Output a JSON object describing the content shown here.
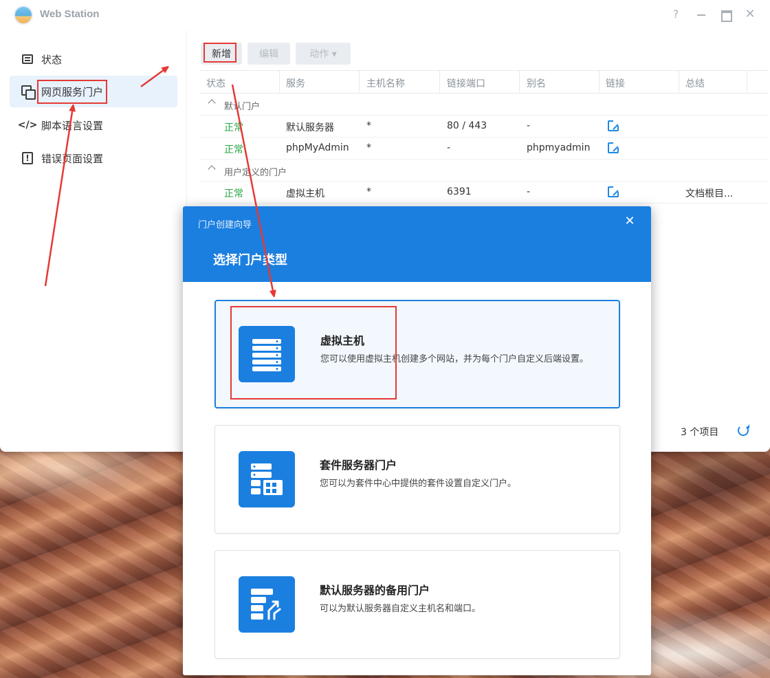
{
  "window": {
    "title": "Web Station",
    "controls": {
      "help": "?",
      "close": "✕"
    }
  },
  "sidebar": {
    "items": [
      {
        "label": "状态",
        "icon": "status-icon"
      },
      {
        "label": "网页服务门户",
        "icon": "portal-icon",
        "active": true
      },
      {
        "label": "脚本语言设置",
        "icon": "code-icon",
        "glyph": "</>"
      },
      {
        "label": "错误页面设置",
        "icon": "error-page-icon",
        "glyph": "!"
      }
    ]
  },
  "toolbar": {
    "new_label": "新增",
    "edit_label": "编辑",
    "action_label": "动作 ▾"
  },
  "table": {
    "columns": [
      "状态",
      "服务",
      "主机名称",
      "链接端口",
      "别名",
      "链接",
      "总结"
    ],
    "groups": [
      {
        "label": "默认门户",
        "rows": [
          {
            "status": "正常",
            "service": "默认服务器",
            "host": "*",
            "port": "80 / 443",
            "alias": "-",
            "summary": ""
          },
          {
            "status": "正常",
            "service": "phpMyAdmin",
            "host": "*",
            "port": "-",
            "alias": "phpmyadmin",
            "summary": ""
          }
        ]
      },
      {
        "label": "用户定义的门户",
        "rows": [
          {
            "status": "正常",
            "service": "虚拟主机",
            "host": "*",
            "port": "6391",
            "alias": "-",
            "summary": "文档根目..."
          }
        ]
      }
    ],
    "item_count": "3 个项目"
  },
  "modal": {
    "small_title": "门户创建向导",
    "title": "选择门户类型",
    "close": "✕",
    "options": [
      {
        "name": "虚拟主机",
        "desc": "您可以使用虚拟主机创建多个网站，并为每个门户自定义后端设置。",
        "icon": "virtual-host-icon",
        "selected": true
      },
      {
        "name": "套件服务器门户",
        "desc": "您可以为套件中心中提供的套件设置自定义门户。",
        "icon": "package-server-icon"
      },
      {
        "name": "默认服务器的备用门户",
        "desc": "可以为默认服务器自定义主机名和端口。",
        "icon": "alternate-portal-icon"
      }
    ]
  },
  "colors": {
    "accent": "#1b7fe0",
    "status_ok": "#28a745",
    "annotation": "#e53935"
  }
}
